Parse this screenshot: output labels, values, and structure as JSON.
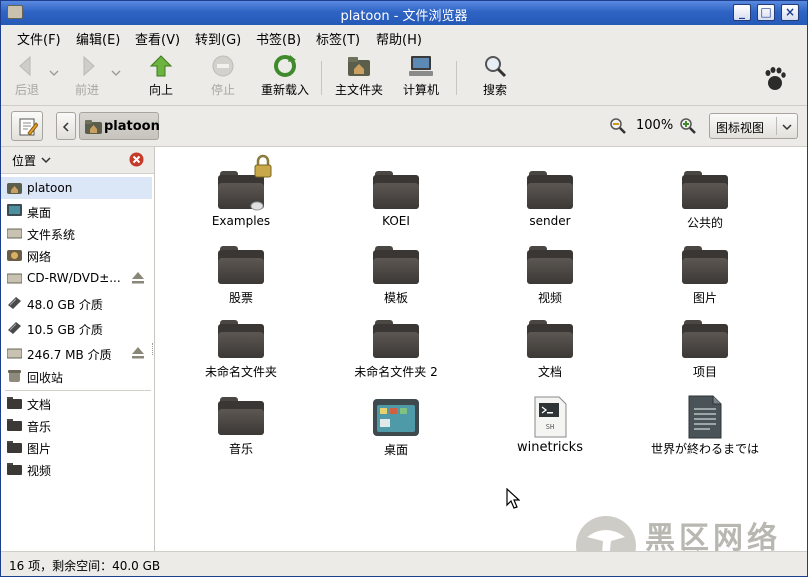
{
  "window": {
    "title": "platoon - 文件浏览器"
  },
  "menubar": {
    "items": [
      "文件(F)",
      "编辑(E)",
      "查看(V)",
      "转到(G)",
      "书签(B)",
      "标签(T)",
      "帮助(H)"
    ]
  },
  "toolbar": {
    "back": "后退",
    "forward": "前进",
    "up": "向上",
    "stop": "停止",
    "reload": "重新载入",
    "home": "主文件夹",
    "computer": "计算机",
    "search": "搜索"
  },
  "location": {
    "path_button": "platoon",
    "zoom": "100%",
    "view_mode": "图标视图"
  },
  "sidebar": {
    "header": "位置",
    "places": [
      {
        "label": "platoon",
        "icon": "home-folder-icon"
      },
      {
        "label": "桌面",
        "icon": "desktop-icon"
      },
      {
        "label": "文件系统",
        "icon": "drive-icon"
      },
      {
        "label": "网络",
        "icon": "network-icon"
      },
      {
        "label": "CD-RW/DVD±...",
        "icon": "optical-drive-icon"
      },
      {
        "label": "48.0 GB 介质",
        "icon": "disk-icon"
      },
      {
        "label": "10.5 GB 介质",
        "icon": "disk-icon"
      },
      {
        "label": "246.7 MB 介质",
        "icon": "drive-icon"
      },
      {
        "label": "回收站",
        "icon": "trash-icon"
      }
    ],
    "bookmarks": [
      {
        "label": "文档",
        "icon": "folder-icon"
      },
      {
        "label": "音乐",
        "icon": "folder-icon"
      },
      {
        "label": "图片",
        "icon": "folder-icon"
      },
      {
        "label": "视频",
        "icon": "folder-icon"
      }
    ]
  },
  "files": [
    {
      "name": "Examples",
      "type": "folder"
    },
    {
      "name": "KOEI",
      "type": "folder"
    },
    {
      "name": "sender",
      "type": "folder"
    },
    {
      "name": "公共的",
      "type": "folder"
    },
    {
      "name": "股票",
      "type": "folder"
    },
    {
      "name": "模板",
      "type": "folder"
    },
    {
      "name": "视频",
      "type": "folder"
    },
    {
      "name": "图片",
      "type": "folder"
    },
    {
      "name": "未命名文件夹",
      "type": "folder"
    },
    {
      "name": "未命名文件夹 2",
      "type": "folder"
    },
    {
      "name": "文档",
      "type": "folder"
    },
    {
      "name": "项目",
      "type": "folder"
    },
    {
      "name": "音乐",
      "type": "folder"
    },
    {
      "name": "桌面",
      "type": "desktop"
    },
    {
      "name": "winetricks",
      "type": "script"
    },
    {
      "name": "世界が終わるまでは",
      "type": "text"
    }
  ],
  "statusbar": {
    "text": "16 项，剩余空间：40.0 GB"
  },
  "watermark": {
    "text": "黑区网络",
    "url": "www.heiqu.com"
  }
}
